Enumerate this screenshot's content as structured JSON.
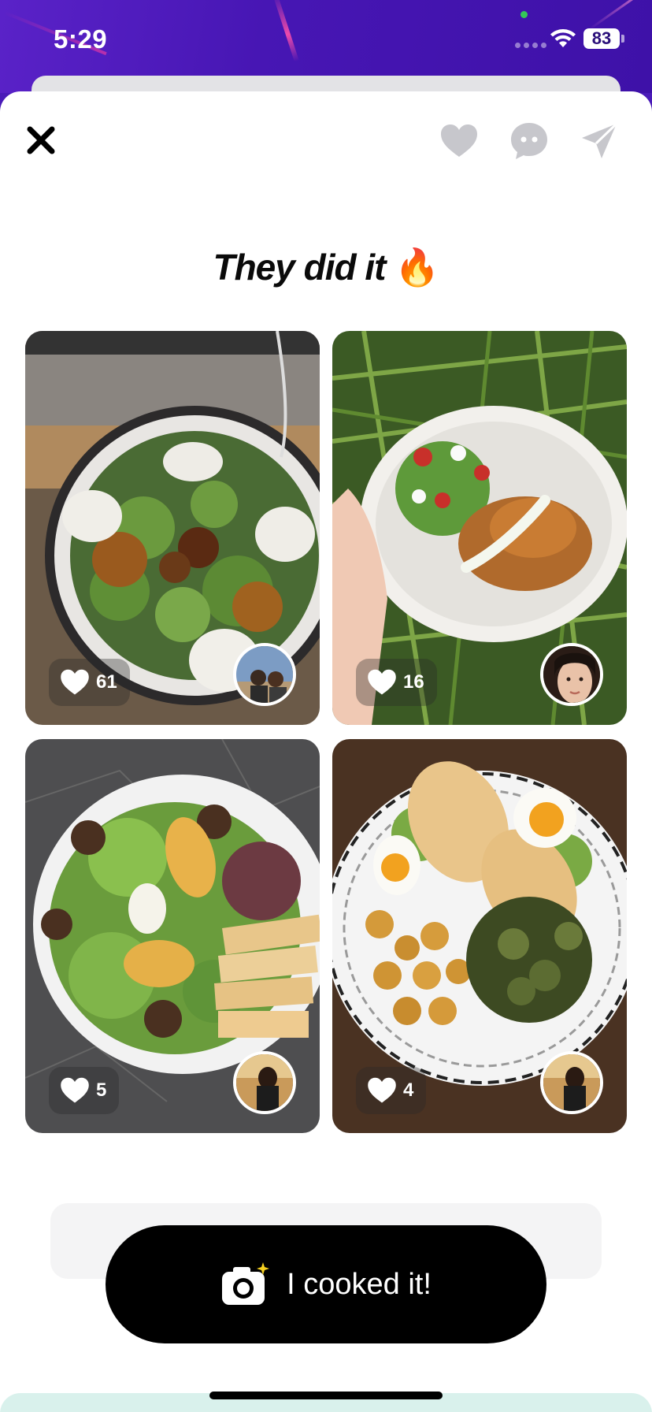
{
  "status_bar": {
    "time": "5:29",
    "battery": "83"
  },
  "header": {
    "close_icon": "close-icon",
    "actions": [
      "heart-icon",
      "comment-icon",
      "send-icon"
    ]
  },
  "title": {
    "text": "They did it",
    "emoji": "🔥"
  },
  "posts": [
    {
      "likes": "61",
      "dish": "salad with goat cheese and figs"
    },
    {
      "likes": "16",
      "dish": "salad with fritters"
    },
    {
      "likes": "5",
      "dish": "salad with toast and egg"
    },
    {
      "likes": "4",
      "dish": "toast, eggs, potatoes and zucchini"
    }
  ],
  "cta": {
    "label": "I cooked it!",
    "icon": "camera-icon"
  },
  "colors": {
    "status_bar": "#4716b4",
    "button": "#000000",
    "accent_heart": "#c7c7cc"
  }
}
